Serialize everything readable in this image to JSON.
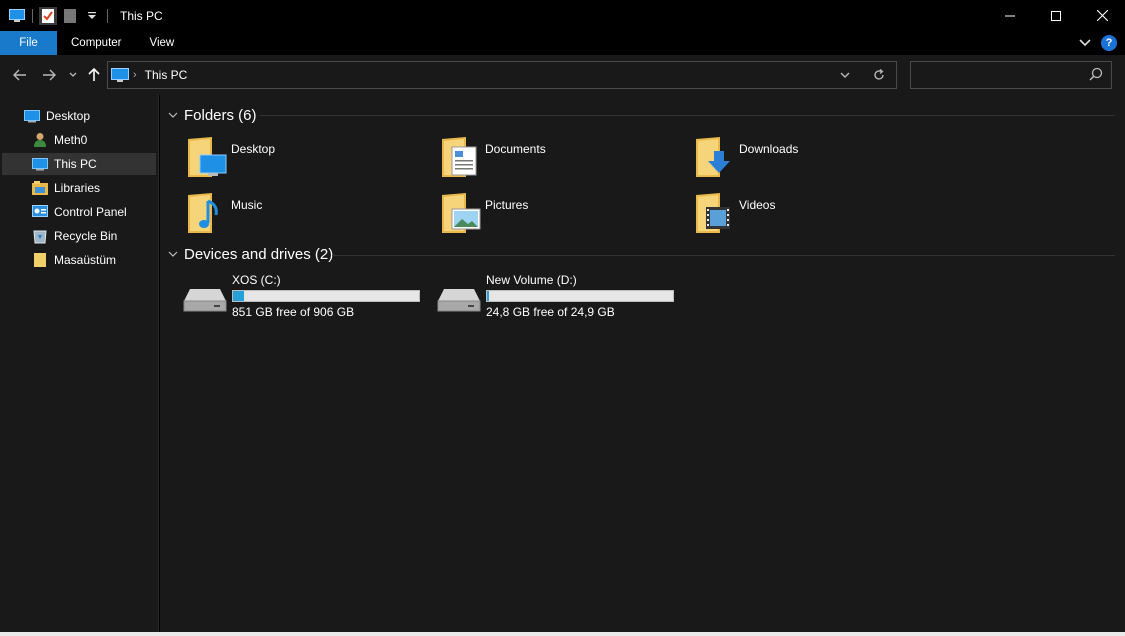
{
  "window": {
    "title": "This PC"
  },
  "ribbon": {
    "tabs": [
      "File",
      "Computer",
      "View"
    ],
    "help": "?"
  },
  "address": {
    "path": "This PC"
  },
  "search": {
    "placeholder": ""
  },
  "sidebar": {
    "items": [
      {
        "label": "Desktop",
        "icon": "desktop-icon"
      },
      {
        "label": "Meth0",
        "icon": "user-icon"
      },
      {
        "label": "This PC",
        "icon": "this-pc-icon",
        "selected": true
      },
      {
        "label": "Libraries",
        "icon": "libraries-icon"
      },
      {
        "label": "Control Panel",
        "icon": "control-panel-icon"
      },
      {
        "label": "Recycle Bin",
        "icon": "recycle-bin-icon"
      },
      {
        "label": "Masaüstüm",
        "icon": "folder-icon"
      }
    ]
  },
  "folders": {
    "header": "Folders (6)",
    "items": [
      {
        "label": "Desktop",
        "icon": "desktop-folder-icon"
      },
      {
        "label": "Documents",
        "icon": "documents-folder-icon"
      },
      {
        "label": "Downloads",
        "icon": "downloads-folder-icon"
      },
      {
        "label": "Music",
        "icon": "music-folder-icon"
      },
      {
        "label": "Pictures",
        "icon": "pictures-folder-icon"
      },
      {
        "label": "Videos",
        "icon": "videos-folder-icon"
      }
    ]
  },
  "drives": {
    "header": "Devices and drives (2)",
    "items": [
      {
        "label": "XOS (C:)",
        "free_text": "851 GB free of 906 GB",
        "used_fraction": 0.061
      },
      {
        "label": "New Volume (D:)",
        "free_text": "24,8 GB free of 24,9 GB",
        "used_fraction": 0.004
      }
    ]
  },
  "colors": {
    "accent": "#1979ca",
    "bar_fill": "#26a0da",
    "background": "#191919"
  }
}
